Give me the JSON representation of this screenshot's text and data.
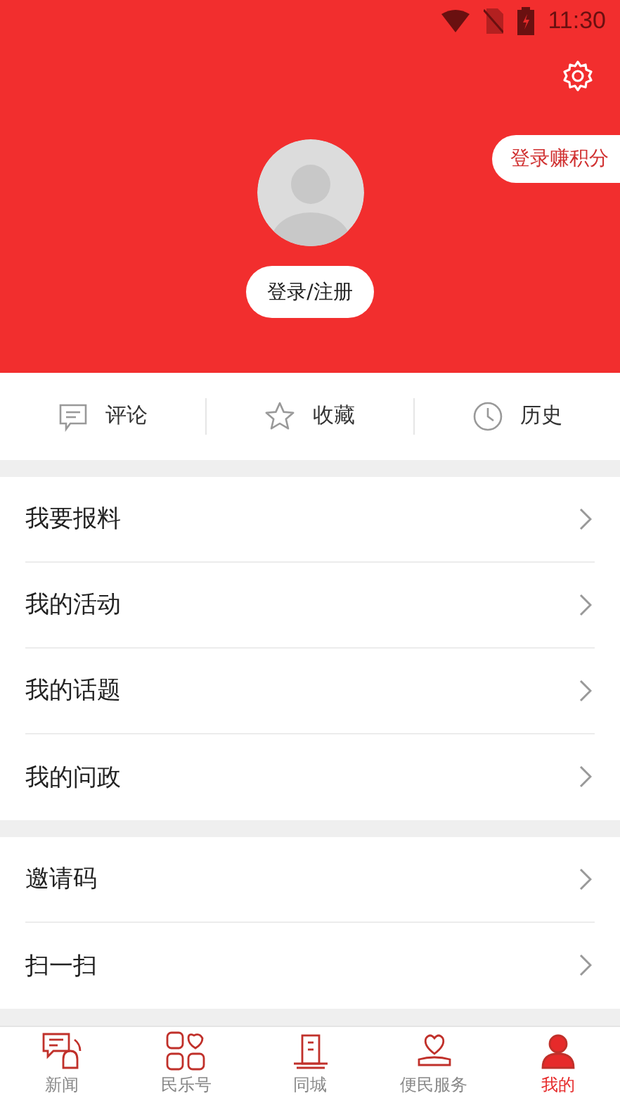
{
  "status_bar": {
    "time": "11:30"
  },
  "header": {
    "login_button": "登录/注册",
    "points_button": "登录赚积分"
  },
  "quick_actions": [
    {
      "kind": "comment",
      "label": "评论"
    },
    {
      "kind": "star",
      "label": "收藏"
    },
    {
      "kind": "clock",
      "label": "历史"
    }
  ],
  "menu_groups": [
    [
      {
        "label": "我要报料"
      },
      {
        "label": "我的活动"
      },
      {
        "label": "我的话题"
      },
      {
        "label": "我的问政"
      }
    ],
    [
      {
        "label": "邀请码"
      },
      {
        "label": "扫一扫"
      }
    ]
  ],
  "bottom_nav": [
    {
      "kind": "news",
      "label": "新闻",
      "selected": false
    },
    {
      "kind": "grid",
      "label": "民乐号",
      "selected": false
    },
    {
      "kind": "city",
      "label": "同城",
      "selected": false
    },
    {
      "kind": "service",
      "label": "便民服务",
      "selected": false
    },
    {
      "kind": "me",
      "label": "我的",
      "selected": true
    }
  ]
}
